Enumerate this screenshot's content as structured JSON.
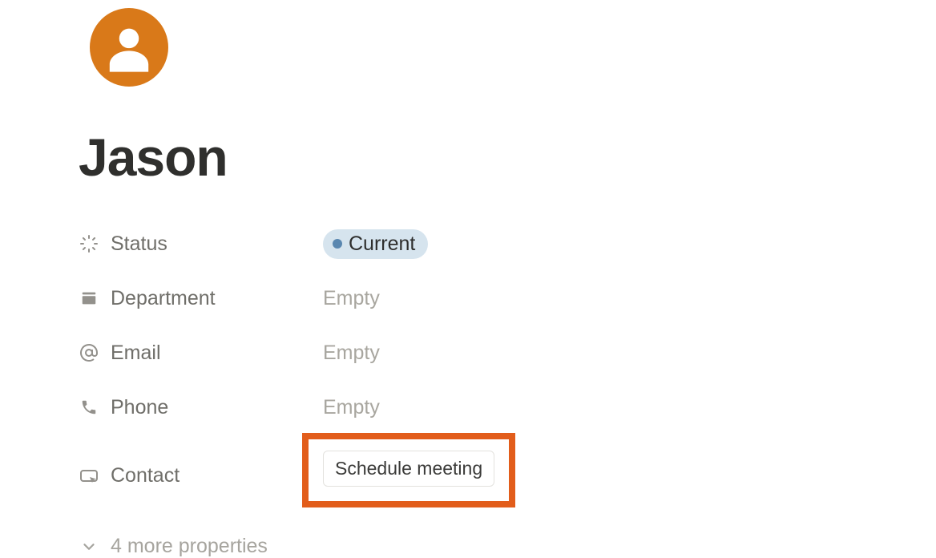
{
  "page": {
    "title": "Jason"
  },
  "properties": {
    "status": {
      "label": "Status",
      "value": "Current"
    },
    "department": {
      "label": "Department",
      "placeholder": "Empty"
    },
    "email": {
      "label": "Email",
      "placeholder": "Empty"
    },
    "phone": {
      "label": "Phone",
      "placeholder": "Empty"
    },
    "contact": {
      "label": "Contact",
      "button": "Schedule meeting"
    },
    "more": {
      "label": "4 more properties"
    }
  }
}
